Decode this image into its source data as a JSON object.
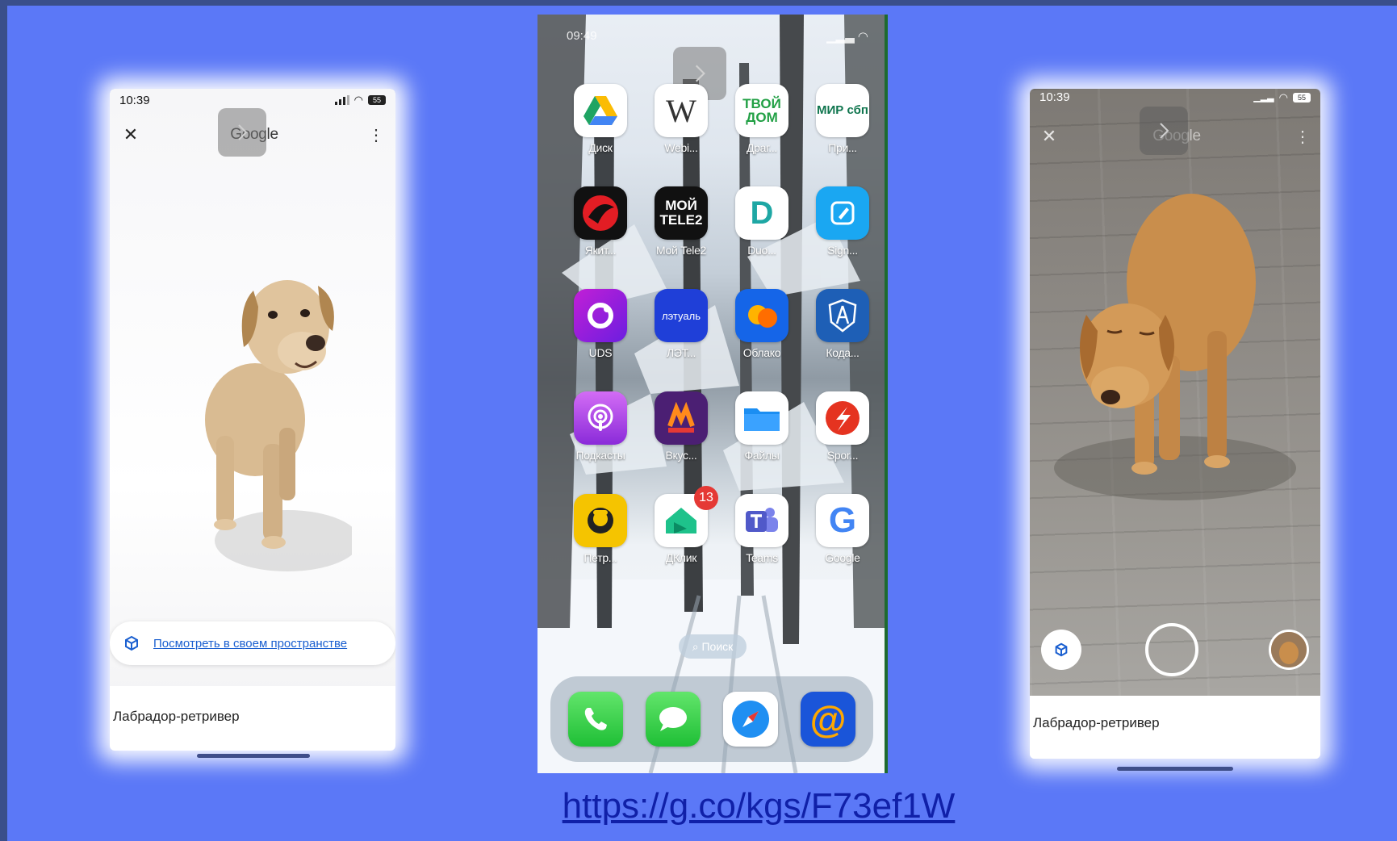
{
  "link": {
    "url_text": "https://g.co/kgs/F73ef1W"
  },
  "left_phone": {
    "time": "10:39",
    "battery": "55",
    "header_title": "Google",
    "ar_button_label": "Посмотреть в своем пространстве",
    "caption": "Лабрадор-ретривер"
  },
  "middle_phone": {
    "time": "09:49",
    "apps": [
      {
        "label": "Диск",
        "icon": "google-drive-icon"
      },
      {
        "label": "Webi...",
        "icon": "w-letter-icon"
      },
      {
        "label": "Драг...",
        "icon": "tvoy-dom-icon",
        "icon_text": "ТВОЙ ДОМ"
      },
      {
        "label": "При...",
        "icon": "mir-sbp-icon",
        "icon_text": "МИР сбп"
      },
      {
        "label": "Якит...",
        "icon": "yakitoriya-icon"
      },
      {
        "label": "Мой Tele2",
        "icon": "tele2-icon",
        "icon_text": "МОЙ TELE2"
      },
      {
        "label": "Duo...",
        "icon": "duolingo-d-icon",
        "icon_text": "D"
      },
      {
        "label": "Sign...",
        "icon": "sign-pen-icon"
      },
      {
        "label": "UDS",
        "icon": "uds-icon"
      },
      {
        "label": "ЛЭТ...",
        "icon": "letual-icon",
        "icon_text": "лэтуаль"
      },
      {
        "label": "Облако",
        "icon": "cloud-icon"
      },
      {
        "label": "Кода...",
        "icon": "compass-shield-icon"
      },
      {
        "label": "Подкасты",
        "icon": "podcasts-icon"
      },
      {
        "label": "Вкус...",
        "icon": "vkusno-icon"
      },
      {
        "label": "Файлы",
        "icon": "files-folder-icon"
      },
      {
        "label": "Spor...",
        "icon": "sportmaster-icon"
      },
      {
        "label": "Петр...",
        "icon": "petrovich-icon"
      },
      {
        "label": "ДКлик",
        "icon": "dklik-house-icon",
        "badge": "13"
      },
      {
        "label": "Teams",
        "icon": "teams-icon"
      },
      {
        "label": "Google",
        "icon": "google-g-icon",
        "icon_text": "G"
      }
    ],
    "search_label": "Поиск",
    "dock": [
      {
        "icon": "phone-icon"
      },
      {
        "icon": "messages-icon"
      },
      {
        "icon": "safari-icon"
      },
      {
        "icon": "mail-at-icon",
        "icon_text": "@"
      }
    ]
  },
  "right_phone": {
    "time": "10:39",
    "battery": "55",
    "header_title": "Google",
    "caption": "Лабрадор-ретривер"
  },
  "colors": {
    "background": "#5b78f7",
    "link": "#1020a8",
    "google_blue": "#1a5fd0"
  }
}
